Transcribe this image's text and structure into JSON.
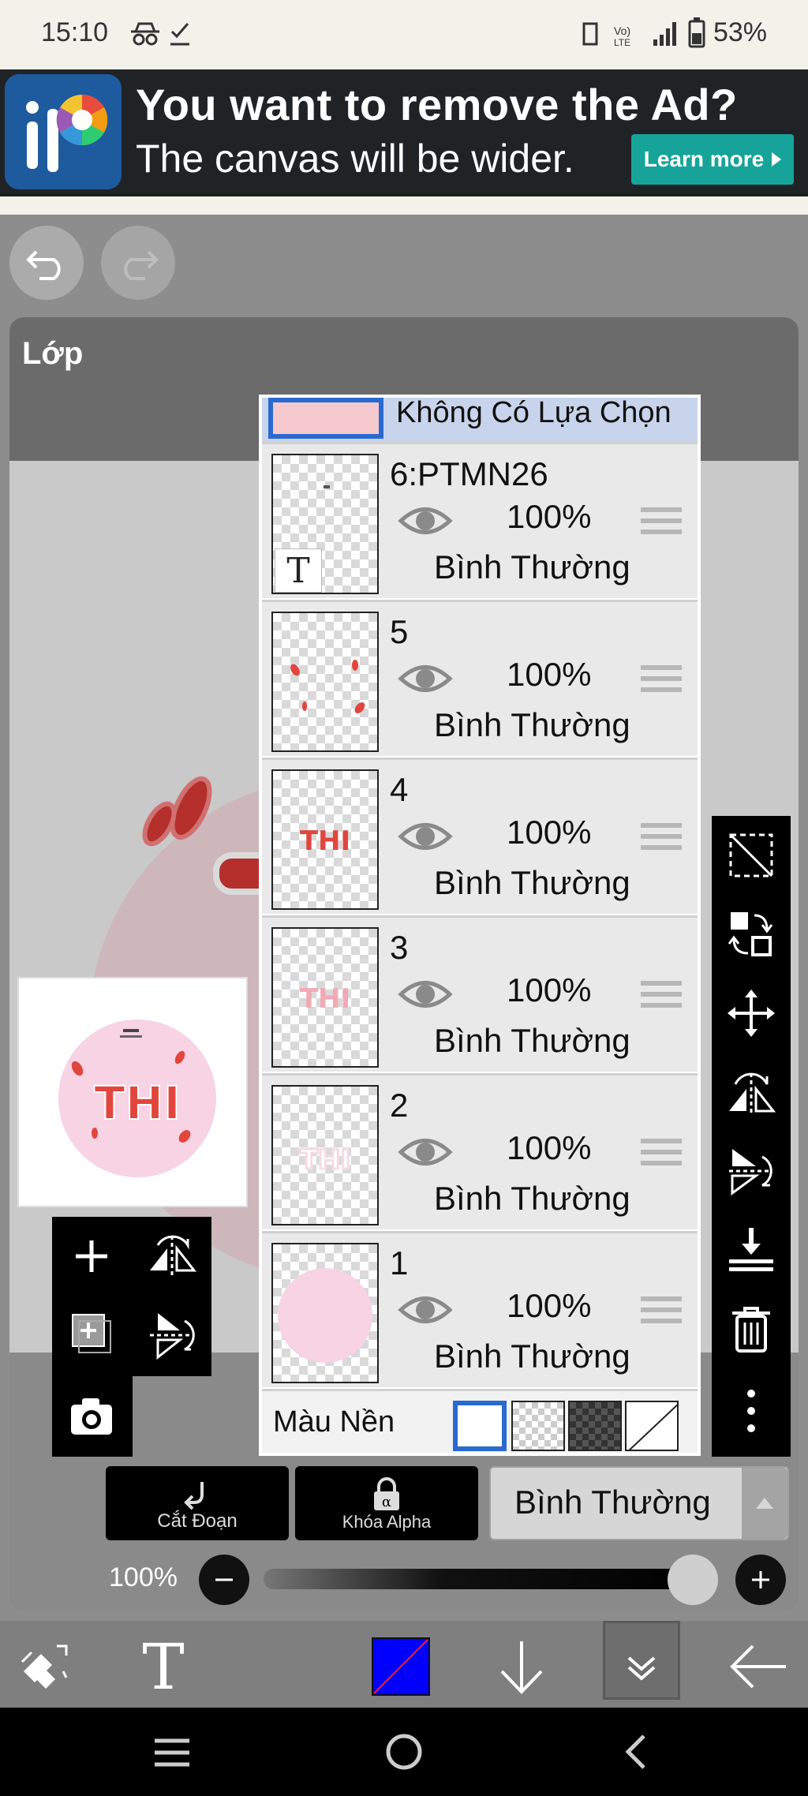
{
  "status_bar": {
    "time": "15:10",
    "battery": "53%"
  },
  "ad": {
    "title": "You want to remove the Ad?",
    "subtitle": "The canvas will be wider.",
    "learn_more": "Learn more"
  },
  "panel": {
    "title": "Lớp"
  },
  "layers": {
    "selection_label": "Không Có Lựa Chọn",
    "items": [
      {
        "name": "6:PTMN26",
        "opacity": "100%",
        "blend": "Bình Thường"
      },
      {
        "name": "5",
        "opacity": "100%",
        "blend": "Bình Thường"
      },
      {
        "name": "4",
        "opacity": "100%",
        "blend": "Bình Thường"
      },
      {
        "name": "3",
        "opacity": "100%",
        "blend": "Bình Thường"
      },
      {
        "name": "2",
        "opacity": "100%",
        "blend": "Bình Thường"
      },
      {
        "name": "1",
        "opacity": "100%",
        "blend": "Bình Thường"
      }
    ],
    "thumb_text": "THI",
    "background_label": "Màu Nền"
  },
  "preview": {
    "text": "THI"
  },
  "controls": {
    "clipping": "Cắt Đoạn",
    "alpha_lock": "Khóa Alpha",
    "blend_mode": "Bình Thường",
    "opacity": "100%",
    "opacity_value": 1.0
  },
  "colors": {
    "accent_blue": "#2a6ad0",
    "current_color": "#0000ff",
    "teal": "#16a39a",
    "thi_red": "#e2453c"
  }
}
